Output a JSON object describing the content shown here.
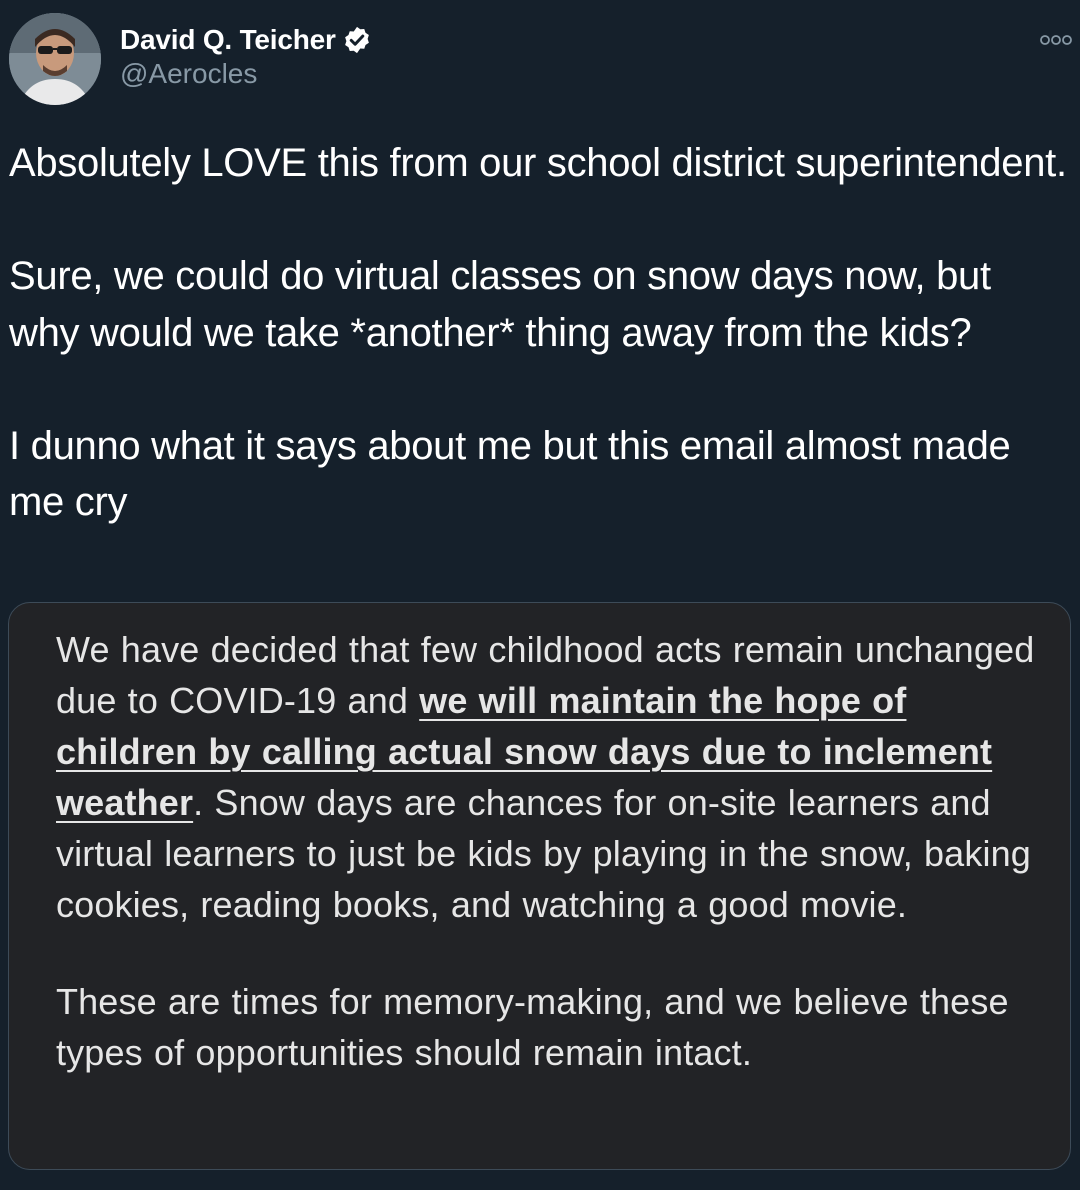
{
  "author": {
    "display_name": "David Q. Teicher",
    "handle": "@Aerocles",
    "verified": true,
    "avatar_icon": "profile-photo"
  },
  "menu": {
    "icon": "more-options-icon"
  },
  "tweet": {
    "paragraphs": [
      "Absolutely LOVE this from our school district superintendent.",
      "Sure, we could do virtual classes on snow days now, but why would we take *another* thing away from the kids?",
      "I dunno what it says about me but this email almost made me cry"
    ]
  },
  "media": {
    "p1_before": "We have decided that few childhood acts remain unchanged due to COVID-19 and ",
    "p1_emphasis_1": "we will maintain the hope of children by calling actual snow days due to inclement",
    "p1_emphasis_2": "weather",
    "p1_after": ". Snow days are chances for on-site learners and virtual learners to just be kids by playing in the snow, baking cookies, reading books, and watching a good movie.",
    "p2": "These are times for memory-making, and we believe these types of opportunities should remain intact."
  },
  "colors": {
    "background": "#15202b",
    "handle": "#8899a6",
    "card_background": "#222326",
    "card_border": "#3d4b58"
  }
}
